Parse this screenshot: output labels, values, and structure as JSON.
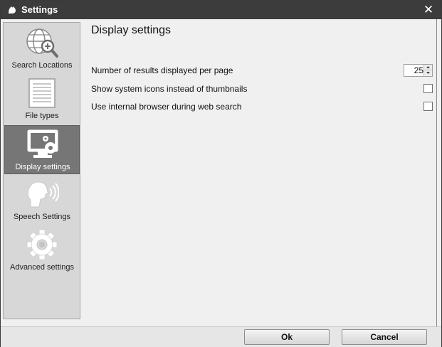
{
  "window": {
    "title": "Settings",
    "close_label": "✕"
  },
  "sidebar": {
    "items": [
      {
        "label": "Search Locations",
        "icon": "globe-search-icon",
        "selected": false
      },
      {
        "label": "File types",
        "icon": "document-icon",
        "selected": false
      },
      {
        "label": "Display settings",
        "icon": "monitor-gear-icon",
        "selected": true
      },
      {
        "label": "Speech Settings",
        "icon": "speaking-head-icon",
        "selected": false
      },
      {
        "label": "Advanced settings",
        "icon": "gear-icon",
        "selected": false
      }
    ]
  },
  "main": {
    "title": "Display settings",
    "settings": [
      {
        "label": "Number of results displayed per page",
        "type": "spinner",
        "value": "25"
      },
      {
        "label": "Show system icons instead of thumbnails",
        "type": "checkbox",
        "checked": false
      },
      {
        "label": "Use internal browser during web search",
        "type": "checkbox",
        "checked": false
      }
    ]
  },
  "footer": {
    "ok_label": "Ok",
    "cancel_label": "Cancel"
  },
  "colors": {
    "titlebar": "#3c3c3c",
    "sidebar_bg": "#d7d7d7",
    "selected_item": "#767676",
    "window_bg": "#f0f0f0"
  }
}
